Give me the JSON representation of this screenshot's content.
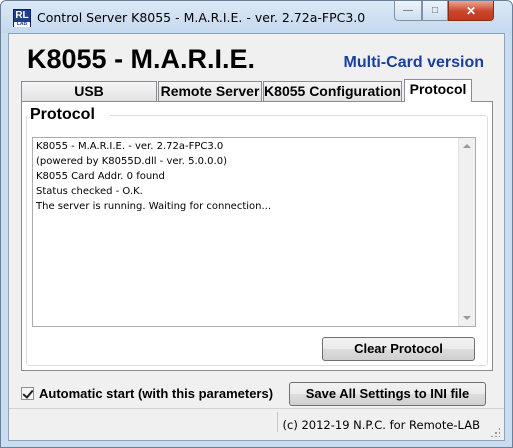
{
  "window": {
    "title": "Control Server K8055 - M.A.R.I.E. - ver. 2.72a-FPC3.0",
    "icon_letters": "RL",
    "icon_sub": "LAB",
    "controls": {
      "min": "—",
      "max": "□",
      "close": "✕"
    }
  },
  "header": {
    "title": "K8055 - M.A.R.I.E.",
    "version_label": "Multi-Card version"
  },
  "tabs": [
    {
      "label": "USB Communication"
    },
    {
      "label": "Remote Server"
    },
    {
      "label": "K8055 Configuration"
    },
    {
      "label": "Protocol",
      "active": true
    }
  ],
  "protocol": {
    "group_title": "Protocol",
    "log_lines": [
      "K8055 - M.A.R.I.E. - ver. 2.72a-FPC3.0",
      "(powered by K8055D.dll - ver. 5.0.0.0)",
      "K8055 Card Addr. 0 found",
      "Status checked - O.K.",
      "The server is running. Waiting for connection..."
    ],
    "clear_button": "Clear Protocol"
  },
  "footer": {
    "autostart_label": "Automatic start (with this parameters)",
    "autostart_checked": true,
    "save_button": "Save All Settings to INI file",
    "status_text": "(c) 2012-19 N.P.C. for Remote-LAB"
  },
  "colors": {
    "version_label": "#1a3f9c",
    "close_button": "#c9452c"
  }
}
